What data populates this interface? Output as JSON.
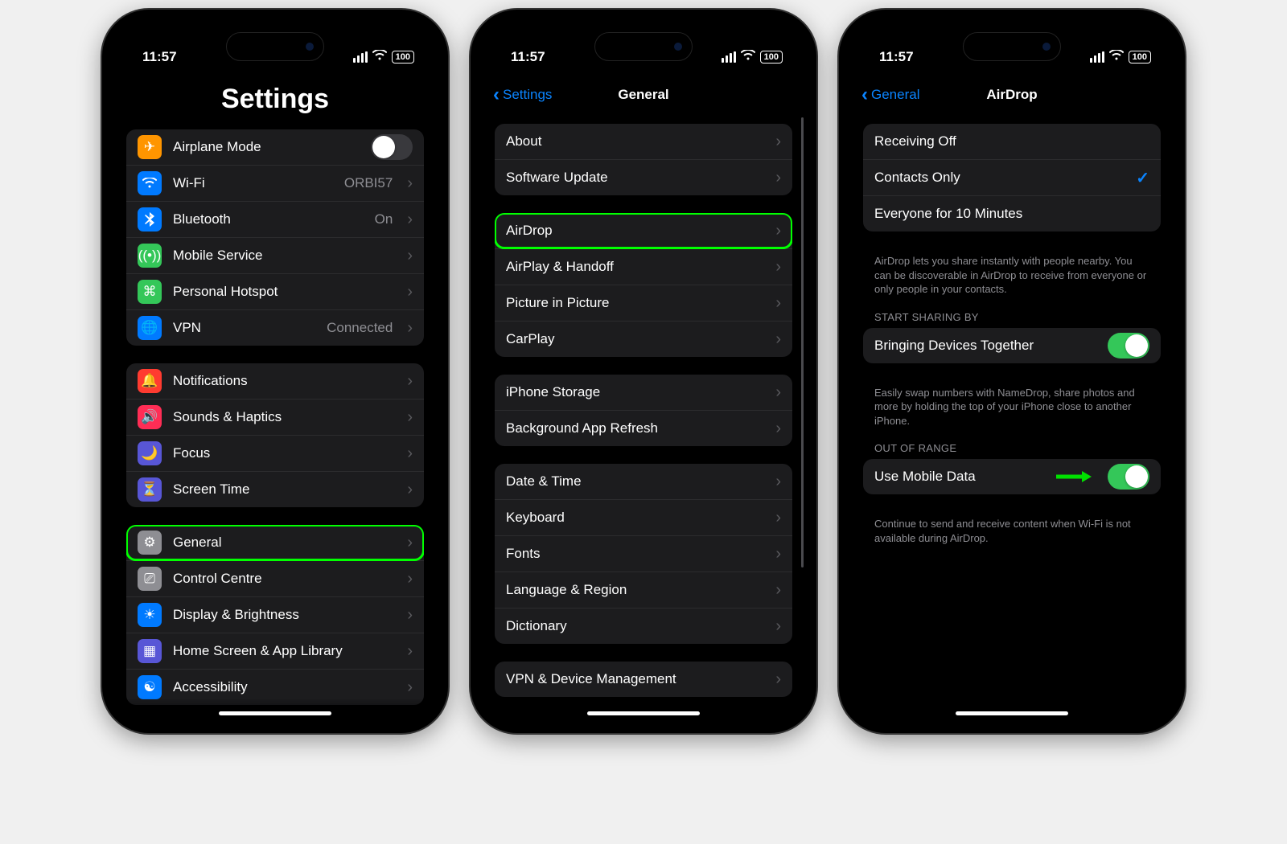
{
  "status": {
    "time": "11:57",
    "battery": "100"
  },
  "screen1": {
    "title": "Settings",
    "g1": [
      {
        "icon": "✈︎",
        "bg": "#ff9500",
        "label": "Airplane Mode",
        "kind": "toggle",
        "on": false,
        "name": "airplane-mode"
      },
      {
        "icon": "wifi",
        "bg": "#007aff",
        "label": "Wi-Fi",
        "kind": "link",
        "detail": "ORBI57",
        "name": "wifi"
      },
      {
        "icon": "bt",
        "bg": "#007aff",
        "label": "Bluetooth",
        "kind": "link",
        "detail": "On",
        "name": "bluetooth"
      },
      {
        "icon": "((•))",
        "bg": "#34c759",
        "label": "Mobile Service",
        "kind": "link",
        "name": "mobile-service"
      },
      {
        "icon": "⌘",
        "bg": "#34c759",
        "label": "Personal Hotspot",
        "kind": "link",
        "name": "personal-hotspot"
      },
      {
        "icon": "🌐",
        "bg": "#007aff",
        "label": "VPN",
        "kind": "link",
        "detail": "Connected",
        "name": "vpn"
      }
    ],
    "g2": [
      {
        "icon": "🔔",
        "bg": "#ff3b30",
        "label": "Notifications",
        "name": "notifications"
      },
      {
        "icon": "🔊",
        "bg": "#ff2d55",
        "label": "Sounds & Haptics",
        "name": "sounds-haptics"
      },
      {
        "icon": "🌙",
        "bg": "#5856d6",
        "label": "Focus",
        "name": "focus"
      },
      {
        "icon": "⏳",
        "bg": "#5856d6",
        "label": "Screen Time",
        "name": "screen-time"
      }
    ],
    "g3": [
      {
        "icon": "⚙︎",
        "bg": "#8e8e93",
        "label": "General",
        "name": "general",
        "hl": true
      },
      {
        "icon": "⎚",
        "bg": "#8e8e93",
        "label": "Control Centre",
        "name": "control-centre"
      },
      {
        "icon": "☀︎",
        "bg": "#007aff",
        "label": "Display & Brightness",
        "name": "display-brightness"
      },
      {
        "icon": "▦",
        "bg": "#5856d6",
        "label": "Home Screen & App Library",
        "name": "home-screen"
      },
      {
        "icon": "☯",
        "bg": "#007aff",
        "label": "Accessibility",
        "name": "accessibility"
      }
    ]
  },
  "screen2": {
    "back": "Settings",
    "title": "General",
    "g1": [
      {
        "label": "About",
        "name": "about"
      },
      {
        "label": "Software Update",
        "name": "software-update"
      }
    ],
    "g2": [
      {
        "label": "AirDrop",
        "name": "airdrop",
        "hl": true
      },
      {
        "label": "AirPlay & Handoff",
        "name": "airplay-handoff"
      },
      {
        "label": "Picture in Picture",
        "name": "pip"
      },
      {
        "label": "CarPlay",
        "name": "carplay"
      }
    ],
    "g3": [
      {
        "label": "iPhone Storage",
        "name": "iphone-storage"
      },
      {
        "label": "Background App Refresh",
        "name": "background-refresh"
      }
    ],
    "g4": [
      {
        "label": "Date & Time",
        "name": "date-time"
      },
      {
        "label": "Keyboard",
        "name": "keyboard"
      },
      {
        "label": "Fonts",
        "name": "fonts"
      },
      {
        "label": "Language & Region",
        "name": "language-region"
      },
      {
        "label": "Dictionary",
        "name": "dictionary"
      }
    ],
    "g5": [
      {
        "label": "VPN & Device Management",
        "name": "vpn-device-mgmt"
      }
    ]
  },
  "screen3": {
    "back": "General",
    "title": "AirDrop",
    "options": [
      {
        "label": "Receiving Off",
        "name": "opt-off",
        "checked": false
      },
      {
        "label": "Contacts Only",
        "name": "opt-contacts",
        "checked": true
      },
      {
        "label": "Everyone for 10 Minutes",
        "name": "opt-everyone",
        "checked": false
      }
    ],
    "options_footer": "AirDrop lets you share instantly with people nearby. You can be discoverable in AirDrop to receive from everyone or only people in your contacts.",
    "sharing_header": "START SHARING BY",
    "sharing": {
      "label": "Bringing Devices Together",
      "on": true,
      "name": "bringing-devices-together"
    },
    "sharing_footer": "Easily swap numbers with NameDrop, share photos and more by holding the top of your iPhone close to another iPhone.",
    "range_header": "OUT OF RANGE",
    "range": {
      "label": "Use Mobile Data",
      "on": true,
      "name": "use-mobile-data",
      "arrow": true
    },
    "range_footer": "Continue to send and receive content when Wi-Fi is not available during AirDrop."
  }
}
